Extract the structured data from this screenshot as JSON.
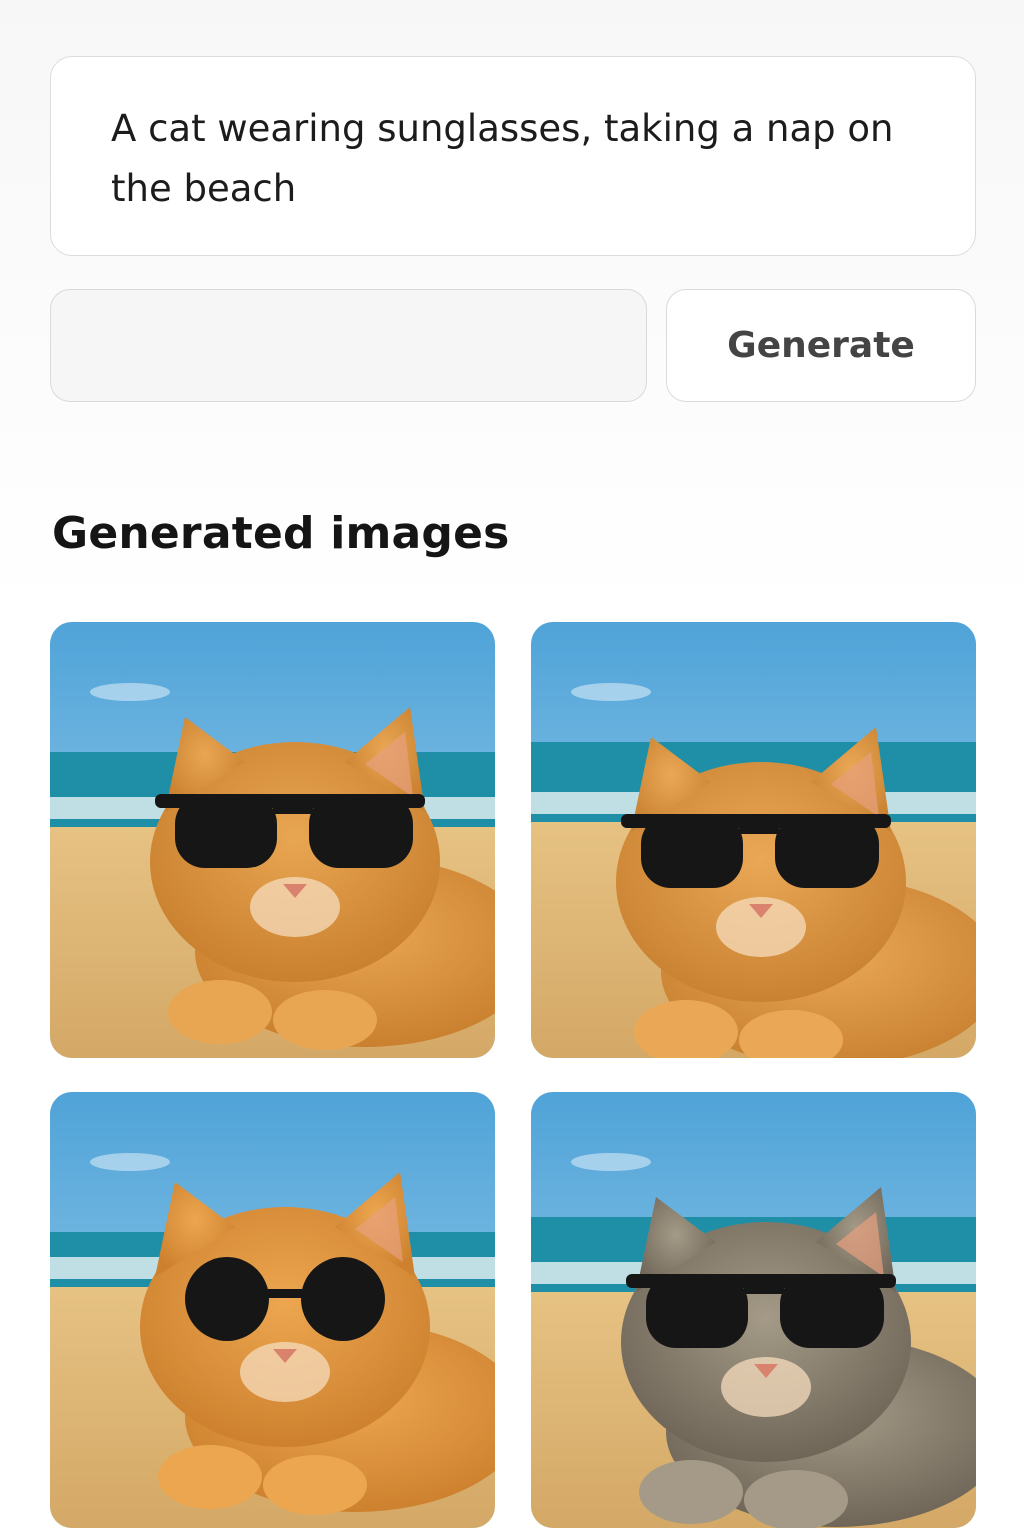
{
  "prompt": {
    "text": "A cat wearing sunglasses, taking a nap on the beach"
  },
  "secondary_input": {
    "value": "",
    "placeholder": ""
  },
  "generate_button": {
    "label": "Generate"
  },
  "results": {
    "title": "Generated images",
    "images": [
      {
        "subject": "orange-tabby-cat",
        "fur": "#e9a652",
        "fur_dark": "#c9802f",
        "accessory": "black-sunglasses"
      },
      {
        "subject": "orange-tabby-cat",
        "fur": "#eaa856",
        "fur_dark": "#c98232",
        "accessory": "black-sunglasses"
      },
      {
        "subject": "orange-tabby-cat",
        "fur": "#eda650",
        "fur_dark": "#cd812e",
        "accessory": "round-black-sunglasses"
      },
      {
        "subject": "grey-tabby-cat",
        "fur": "#a49a87",
        "fur_dark": "#6f6658",
        "accessory": "black-sunglasses"
      }
    ]
  },
  "colors": {
    "sky_top": "#4fa3d8",
    "sky_bottom": "#a9d6ef",
    "sea": "#1f8fa8",
    "sand": "#e6c283",
    "sand_dark": "#d4a866"
  }
}
